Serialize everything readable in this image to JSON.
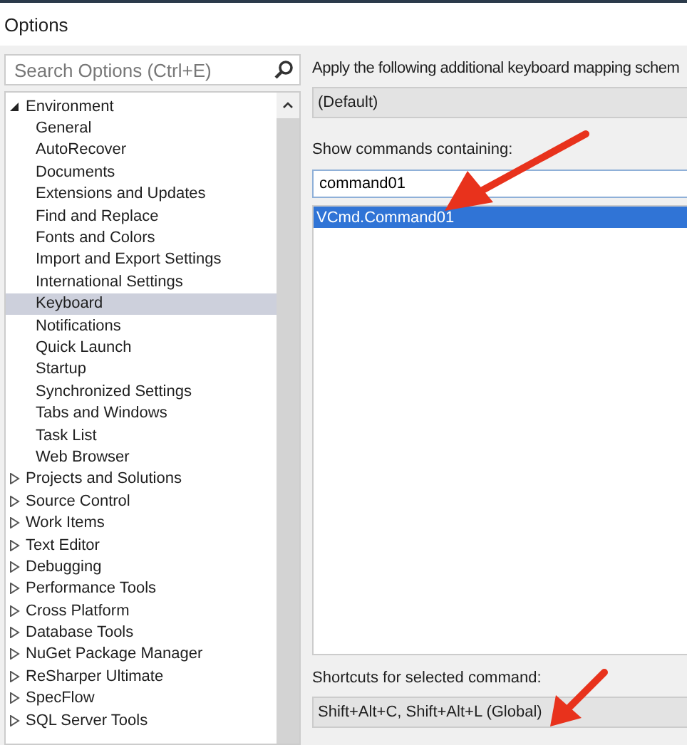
{
  "window": {
    "title": "Options"
  },
  "search": {
    "placeholder": "Search Options (Ctrl+E)"
  },
  "tree": [
    {
      "label": "Environment",
      "expanded": true,
      "selected": false,
      "children": [
        {
          "label": "General",
          "selected": false
        },
        {
          "label": "AutoRecover",
          "selected": false
        },
        {
          "label": "Documents",
          "selected": false
        },
        {
          "label": "Extensions and Updates",
          "selected": false
        },
        {
          "label": "Find and Replace",
          "selected": false
        },
        {
          "label": "Fonts and Colors",
          "selected": false
        },
        {
          "label": "Import and Export Settings",
          "selected": false
        },
        {
          "label": "International Settings",
          "selected": false
        },
        {
          "label": "Keyboard",
          "selected": true
        },
        {
          "label": "Notifications",
          "selected": false
        },
        {
          "label": "Quick Launch",
          "selected": false
        },
        {
          "label": "Startup",
          "selected": false
        },
        {
          "label": "Synchronized Settings",
          "selected": false
        },
        {
          "label": "Tabs and Windows",
          "selected": false
        },
        {
          "label": "Task List",
          "selected": false
        },
        {
          "label": "Web Browser",
          "selected": false
        }
      ]
    },
    {
      "label": "Projects and Solutions",
      "expanded": false,
      "selected": false
    },
    {
      "label": "Source Control",
      "expanded": false,
      "selected": false
    },
    {
      "label": "Work Items",
      "expanded": false,
      "selected": false
    },
    {
      "label": "Text Editor",
      "expanded": false,
      "selected": false
    },
    {
      "label": "Debugging",
      "expanded": false,
      "selected": false
    },
    {
      "label": "Performance Tools",
      "expanded": false,
      "selected": false
    },
    {
      "label": "Cross Platform",
      "expanded": false,
      "selected": false
    },
    {
      "label": "Database Tools",
      "expanded": false,
      "selected": false
    },
    {
      "label": "NuGet Package Manager",
      "expanded": false,
      "selected": false
    },
    {
      "label": "ReSharper Ultimate",
      "expanded": false,
      "selected": false
    },
    {
      "label": "SpecFlow",
      "expanded": false,
      "selected": false
    },
    {
      "label": "SQL Server Tools",
      "expanded": false,
      "selected": false
    }
  ],
  "keyboard": {
    "scheme_label": "Apply the following additional keyboard mapping schem",
    "scheme_value": "(Default)",
    "filter_label": "Show commands containing:",
    "filter_value": "command01",
    "commands": [
      {
        "label": "VCmd.Command01",
        "selected": true
      }
    ],
    "shortcuts_label": "Shortcuts for selected command:",
    "shortcuts_value": "Shift+Alt+C, Shift+Alt+L (Global)"
  }
}
